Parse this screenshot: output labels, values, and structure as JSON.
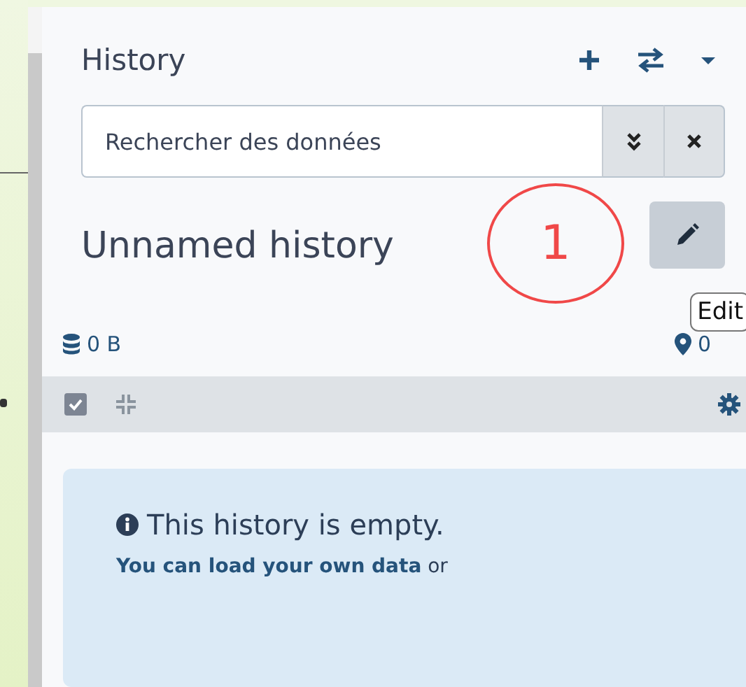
{
  "panel": {
    "title": "History"
  },
  "search": {
    "placeholder": "Rechercher des données"
  },
  "history": {
    "name": "Unnamed history"
  },
  "annotation": {
    "label": "1"
  },
  "tooltip": {
    "text": "Edit"
  },
  "stats": {
    "size": "0 B",
    "count": "0"
  },
  "toolbar": {
    "select_all_checked": true
  },
  "message": {
    "title": "This history is empty.",
    "text": "**You can load your own data** or"
  }
}
